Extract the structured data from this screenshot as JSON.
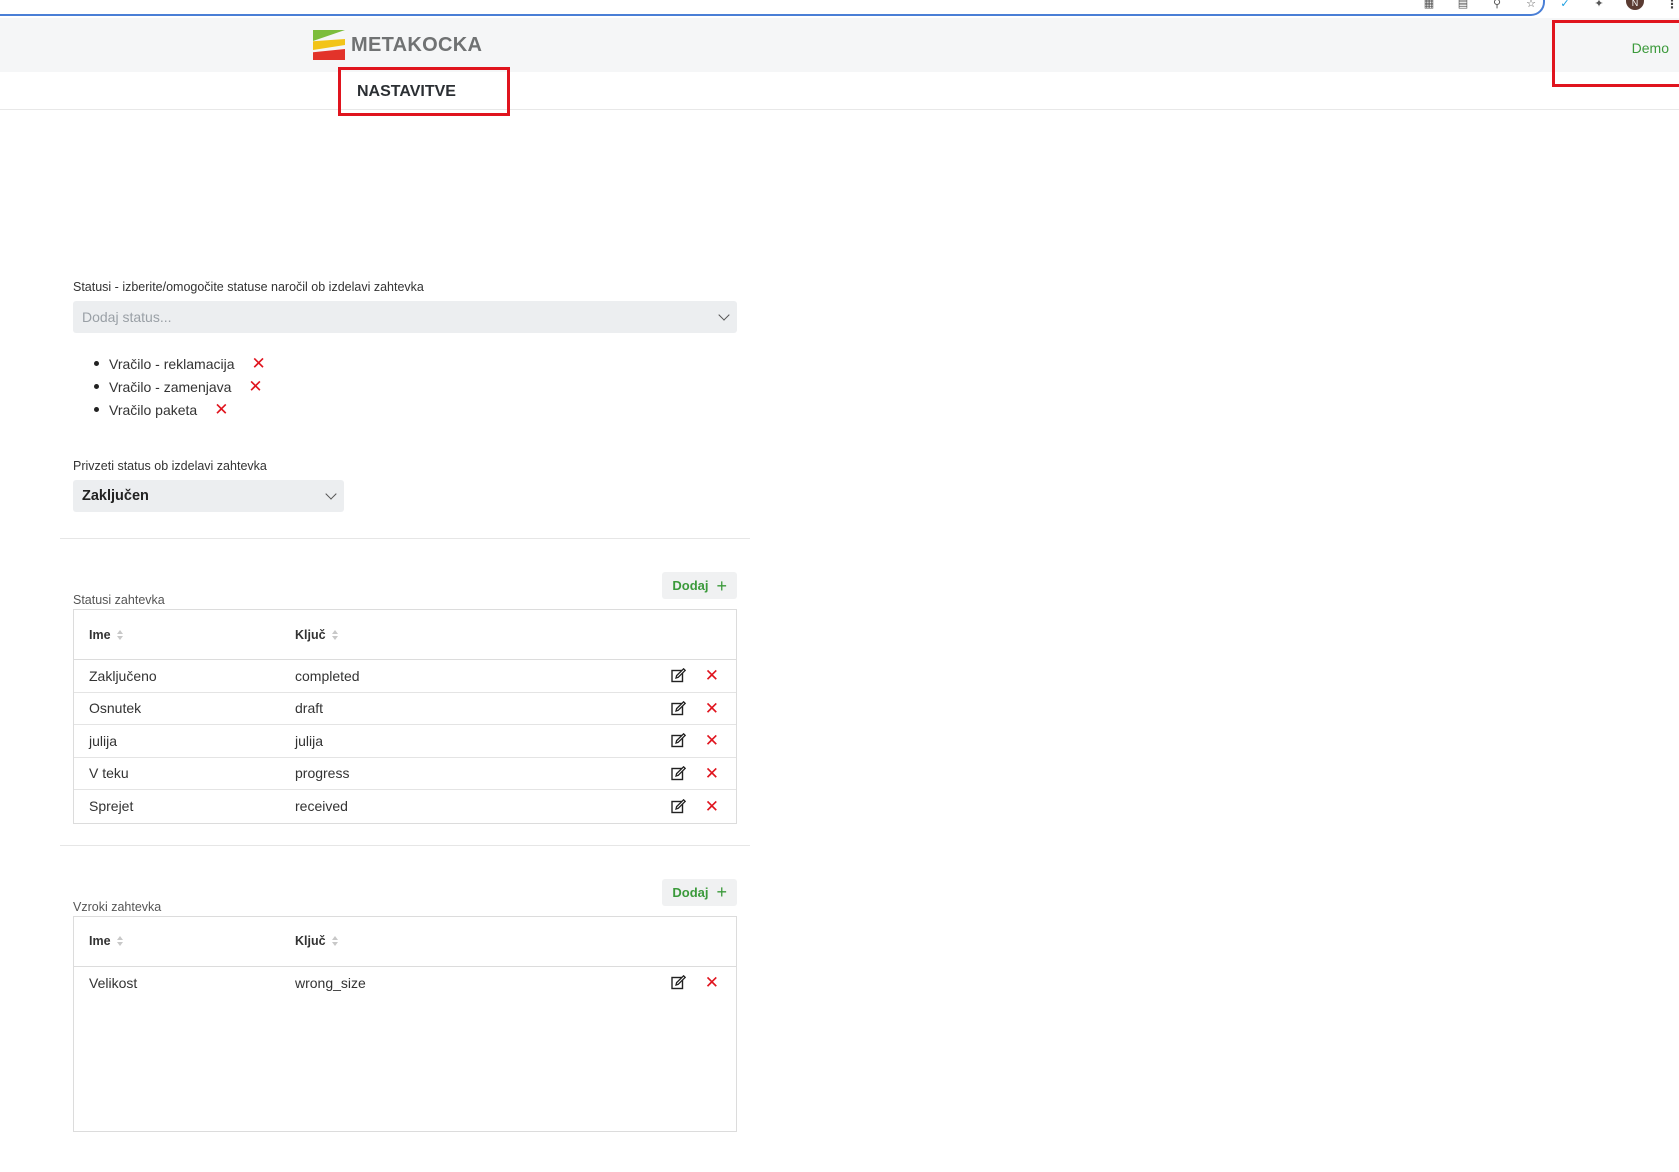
{
  "browser": {
    "icons": [
      "grid-icon",
      "translate-icon",
      "zoom-icon",
      "star-icon",
      "vivaldi-check-icon",
      "extensions-icon"
    ],
    "avatar_letter": "N"
  },
  "header": {
    "logo_text": "METAKOCKA",
    "demo_link": "Demo"
  },
  "nav": {
    "active_tab": "NASTAVITVE"
  },
  "statuses": {
    "label": "Statusi - izberite/omogočite statuse naročil ob izdelavi zahtevka",
    "placeholder": "Dodaj status...",
    "items": [
      "Vračilo - reklamacija",
      "Vračilo - zamenjava",
      "Vračilo paketa"
    ]
  },
  "default_status": {
    "label": "Privzeti status ob izdelavi zahtevka",
    "value": "Zaključen"
  },
  "request_statuses": {
    "title": "Statusi zahtevka",
    "add_label": "Dodaj",
    "columns": [
      "Ime",
      "Ključ"
    ],
    "rows": [
      {
        "name": "Zaključeno",
        "key": "completed"
      },
      {
        "name": "Osnutek",
        "key": "draft"
      },
      {
        "name": "julija",
        "key": "julija"
      },
      {
        "name": "V teku",
        "key": "progress"
      },
      {
        "name": "Sprejet",
        "key": "received"
      }
    ]
  },
  "request_reasons": {
    "title": "Vzroki zahtevka",
    "add_label": "Dodaj",
    "columns": [
      "Ime",
      "Ključ"
    ],
    "rows": [
      {
        "name": "Velikost",
        "key": "wrong_size"
      }
    ]
  },
  "colors": {
    "accent_green": "#3b9a3b",
    "delete_red": "#e0141e",
    "highlight_red": "#e0141e"
  }
}
